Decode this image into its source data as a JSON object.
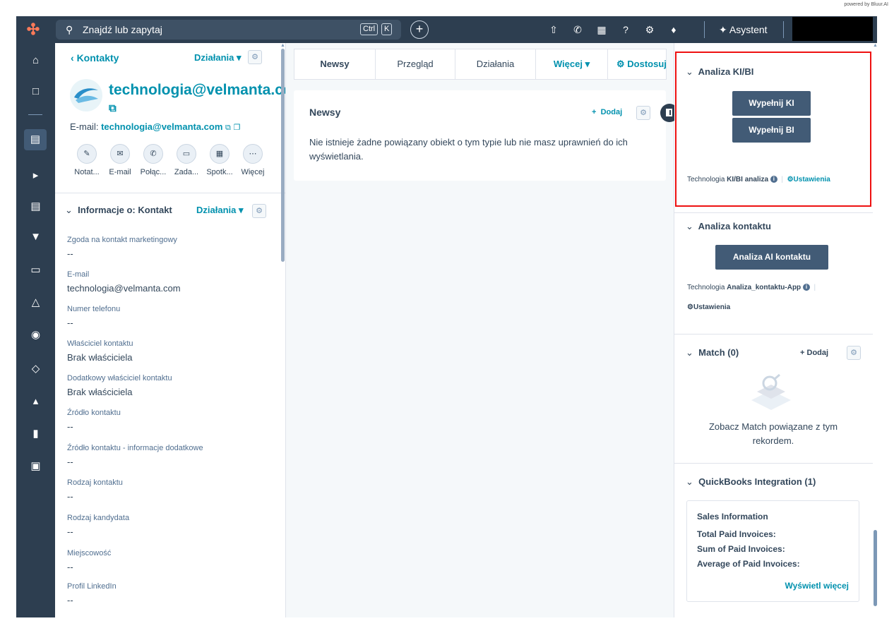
{
  "powered_by": "powered by Bluur.AI",
  "topbar": {
    "search_placeholder": "Znajdź lub zapytaj",
    "kbd_ctrl": "Ctrl",
    "kbd_k": "K",
    "asystent": "Asystent"
  },
  "contact": {
    "back": "Kontakty",
    "actions_label": "Działania",
    "title": "technologia@velmanta.com",
    "email_prefix": "E-mail:",
    "email": "technologia@velmanta.com",
    "quick_actions": [
      "Notat...",
      "E-mail",
      "Połąc...",
      "Zada...",
      "Spotk...",
      "Więcej"
    ]
  },
  "info": {
    "header": "Informacje o: Kontakt",
    "actions_label": "Działania",
    "fields": [
      {
        "label": "Zgoda na kontakt marketingowy",
        "value": "--"
      },
      {
        "label": "E-mail",
        "value": "technologia@velmanta.com"
      },
      {
        "label": "Numer telefonu",
        "value": "--"
      },
      {
        "label": "Właściciel kontaktu",
        "value": "Brak właściciela"
      },
      {
        "label": "Dodatkowy właściciel kontaktu",
        "value": "Brak właściciela"
      },
      {
        "label": "Źródło kontaktu",
        "value": "--"
      },
      {
        "label": "Źródło kontaktu - informacje dodatkowe",
        "value": "--"
      },
      {
        "label": "Rodzaj kontaktu",
        "value": "--"
      },
      {
        "label": "Rodzaj kandydata",
        "value": "--"
      },
      {
        "label": "Miejscowość",
        "value": "--"
      },
      {
        "label": "Profil LinkedIn",
        "value": "--"
      }
    ]
  },
  "tabs": [
    {
      "label": "Newsy"
    },
    {
      "label": "Przegląd"
    },
    {
      "label": "Działania"
    },
    {
      "label": "Więcej ▾"
    },
    {
      "label": "Dostosuj"
    }
  ],
  "news": {
    "title": "Newsy",
    "add": "Dodaj",
    "empty": "Nie istnieje żadne powiązany obiekt o tym typie lub nie masz uprawnień do ich wyświetlania."
  },
  "right": {
    "kibi": {
      "title": "Analiza KI/BI",
      "btn_ki": "Wypełnij KI",
      "btn_bi": "Wypełnij BI",
      "tech_prefix": "Technologia",
      "tech_app": "KI/BI analiza",
      "settings": "Ustawienia"
    },
    "kontakt": {
      "title": "Analiza kontaktu",
      "btn": "Analiza AI kontaktu",
      "tech_prefix": "Technologia",
      "tech_app": "Analiza_kontaktu-App",
      "settings": "Ustawienia"
    },
    "match": {
      "title": "Match (0)",
      "add": "Dodaj",
      "empty": "Zobacz Match powiązane z tym rekordem."
    },
    "quickbooks": {
      "title": "QuickBooks Integration (1)",
      "section": "Sales Information",
      "rows": [
        "Total Paid Invoices:",
        "Sum of Paid Invoices:",
        "Average of Paid Invoices:"
      ],
      "more": "Wyświetl więcej"
    }
  },
  "colors": {
    "topbar": "#2d3e50",
    "accent": "#0091ae",
    "highlight": "#ee1111",
    "button": "#425b76"
  }
}
